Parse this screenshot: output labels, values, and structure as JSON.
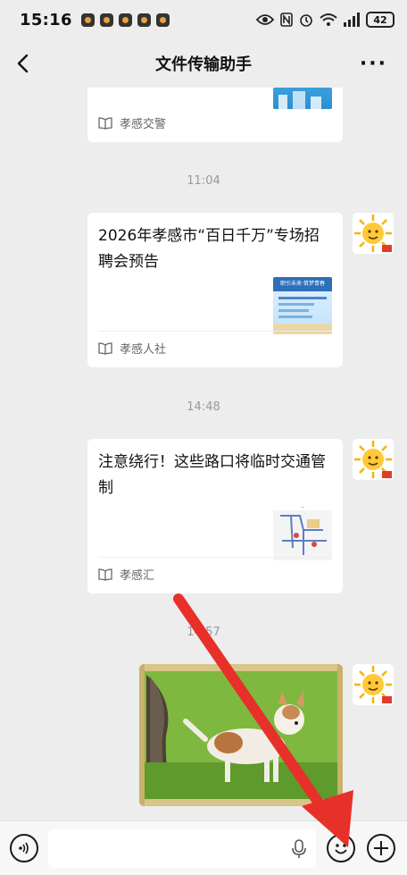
{
  "status_bar": {
    "time": "15:16",
    "battery": "42"
  },
  "header": {
    "title": "文件传输助手"
  },
  "messages": [
    {
      "title": "",
      "source": "孝感交警"
    },
    {
      "time": "11:04",
      "title": "2026年孝感市“百日千万”专场招聘会预告",
      "source": "孝感人社",
      "thumb_caption": "职引未来·筑梦青春"
    },
    {
      "time": "14:48",
      "title": "注意绕行！这些路口将临时交通管制",
      "source": "孝感汇"
    },
    {
      "time": "14:57"
    }
  ],
  "colors": {
    "background": "#ededed",
    "card": "#ffffff",
    "arrow": "#e8302a"
  },
  "icons": {
    "back": "chevron-left-icon",
    "more": "more-dots-icon",
    "voice": "voice-icon",
    "mic": "mic-icon",
    "emoji": "emoji-icon",
    "plus": "plus-icon",
    "article": "book-icon",
    "avatar": "sun-avatar"
  }
}
